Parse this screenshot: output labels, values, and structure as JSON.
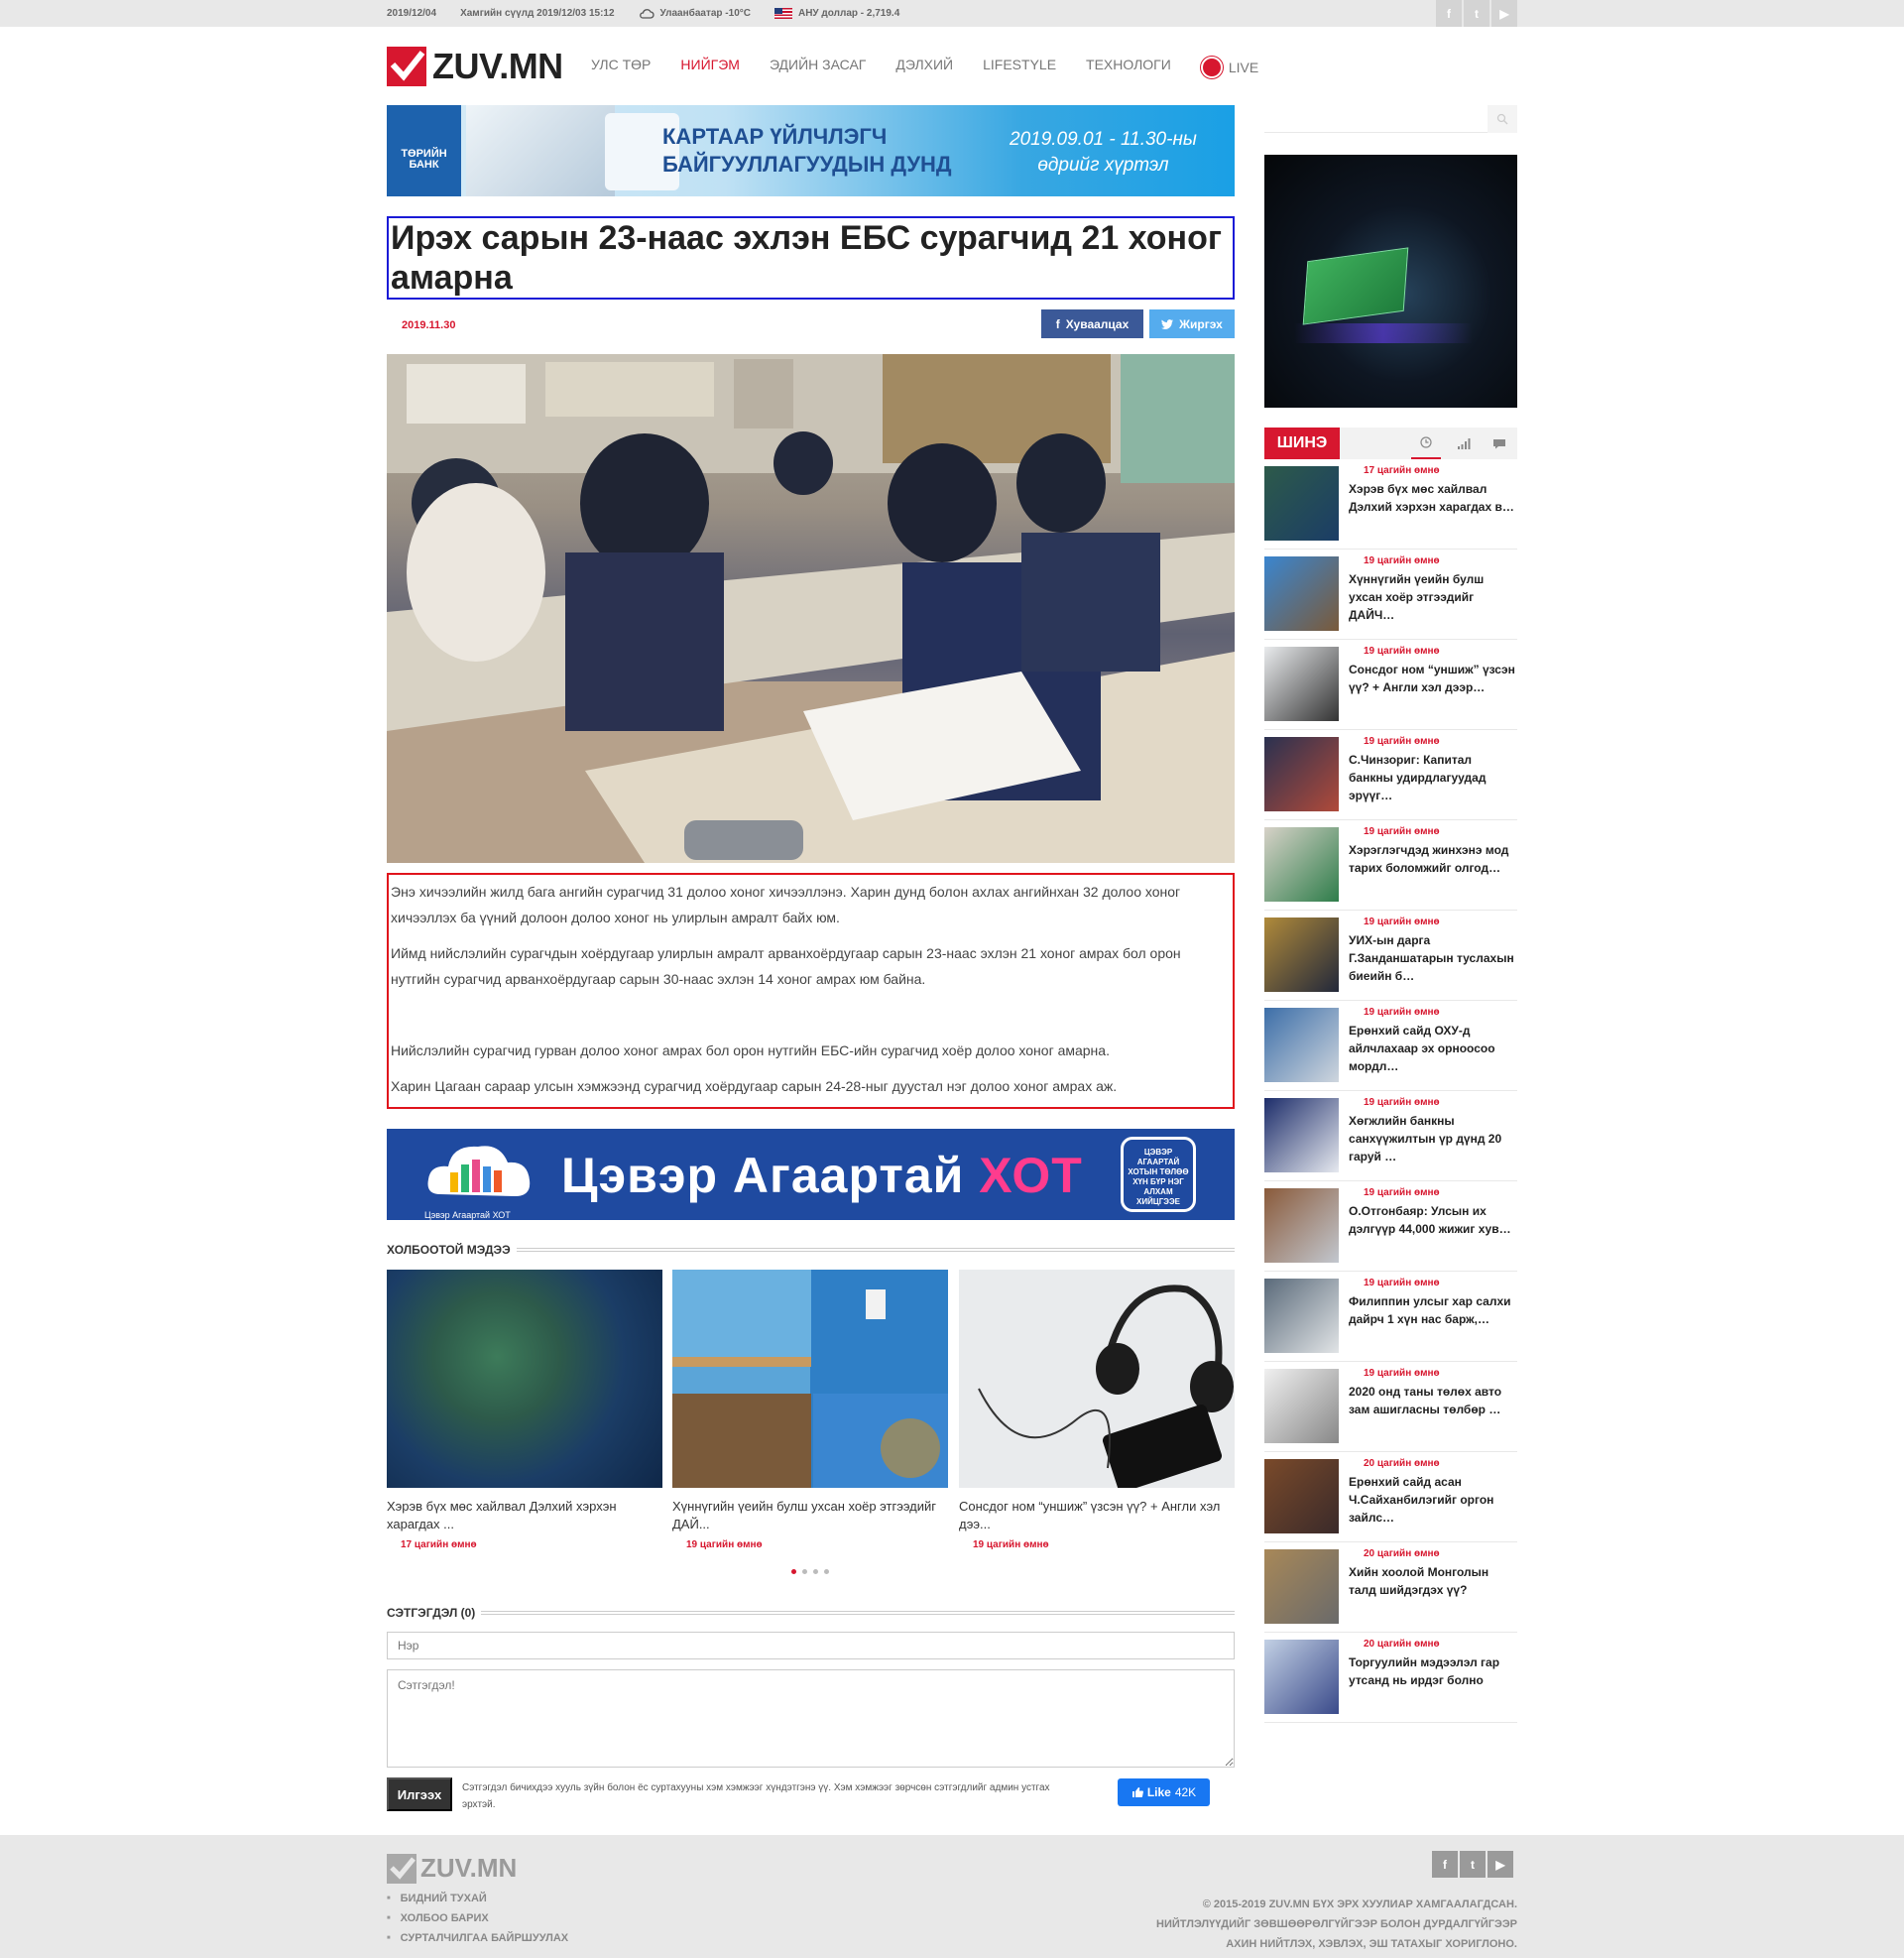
{
  "topbar": {
    "date": "2019/12/04",
    "last_updated": "Хамгийн сүүлд 2019/12/03 15:12",
    "weather": "Улаанбаатар -10°C",
    "currency": "АНУ доллар - 2,719.4",
    "socials": [
      "facebook-icon",
      "twitter-icon",
      "youtube-icon"
    ]
  },
  "header": {
    "logo_text": "ZUV.MN",
    "nav": [
      {
        "label": "УЛС ТӨР"
      },
      {
        "label": "НИЙГЭМ",
        "active": true
      },
      {
        "label": "ЭДИЙН ЗАСАГ"
      },
      {
        "label": "ДЭЛХИЙ"
      },
      {
        "label": "LIFESTYLE"
      },
      {
        "label": "ТЕХНОЛОГИ"
      },
      {
        "label": "LIVE"
      }
    ]
  },
  "banner": {
    "bank": "ТӨРИЙН БАНК",
    "title_line1": "КАРТААР ҮЙЛЧЛЭГЧ",
    "title_line2": "БАЙГУУЛЛАГУУДЫН ДУНД",
    "dates_line1": "2019.09.01 - 11.30-ны",
    "dates_line2": "өдрийг хүртэл"
  },
  "article": {
    "title": "Ирэх сарын 23-наас эхлэн ЕБС сурагчид 21 хоног амарна",
    "date": "2019.11.30",
    "share_fb": "Хуваалцах",
    "share_tw": "Жиргэх",
    "paragraphs": [
      "Энэ хичээлийн жилд бага ангийн сурагчид 31 долоо хоног хичээллэнэ. Харин дунд болон ахлах ангийнхан 32 долоо хоног хичээллэх ба үүний долоон долоо хоног нь улирлын амралт байх юм.",
      "Иймд нийслэлийн сурагчдын хоёрдугаар улирлын амралт арванхоёрдугаар сарын 23-наас эхлэн 21 хоног амрах бол орон нутгийн сурагчид арванхоёрдугаар сарын 30-наас эхлэн 14 хоног амрах юм байна.",
      "Нийслэлийн сурагчид гурван долоо хоног амрах бол орон нутгийн ЕБС-ийн сурагчид хоёр долоо хоног амарна.",
      "Харин Цагаан сараар улсын хэмжээнд сурагчид хоёрдугаар сарын 24-28-ныг дуустал нэг долоо хоног амрах аж."
    ]
  },
  "clean_banner": {
    "text_main": "Цэвэр Агаартай ",
    "text_accent": "ХОТ",
    "small": "Цэвэр Агаартай ХОТ",
    "box": "ЦЭВЭР АГААРТАЙ ХОТЫН ТӨЛӨӨ ХҮН БҮР НЭГ АЛХАМ ХИЙЦГЭЭЕ"
  },
  "related": {
    "heading": "ХОЛБООТОЙ МЭДЭЭ",
    "items": [
      {
        "caption": "Хэрэв бүх мөс хайлвал Дэлхий хэрхэн харагдах ...",
        "time": "17 цагийн өмнө"
      },
      {
        "caption": "Хүннүгийн үеийн булш ухсан хоёр этгээдийг ДАЙ...",
        "time": "19 цагийн өмнө"
      },
      {
        "caption": "Сонсдог ном “уншиж” үзсэн үү? + Англи хэл дээ...",
        "time": "19 цагийн өмнө"
      }
    ]
  },
  "comments": {
    "heading": "СЭТГЭГДЭЛ (0)",
    "name_placeholder": "Нэр",
    "comment_placeholder": "Сэтгэгдэл!",
    "send": "Илгээх",
    "notice": "Сэтгэгдэл бичихдээ хууль зүйн болон ёс суртахууны хэм хэмжээг хүндэтгэнэ үү. Хэм хэмжээг зөрчсөн сэтгэгдлийг админ устгах эрхтэй.",
    "like": "Like",
    "like_count": "42K"
  },
  "sidebar": {
    "tab_new": "ШИНЭ",
    "tab_icons": [
      "clock-icon",
      "signal-icon",
      "comment-icon"
    ],
    "news": [
      {
        "time": "17 цагийн өмнө",
        "title": "Хэрэв бүх мөс хайлвал Дэлхий хэрхэн харагдах в…"
      },
      {
        "time": "19 цагийн өмнө",
        "title": "Хүннүгийн үеийн булш ухсан хоёр этгээдийг ДАЙЧ…"
      },
      {
        "time": "19 цагийн өмнө",
        "title": "Сонсдог ном “уншиж” үзсэн үү? + Англи хэл дээр…"
      },
      {
        "time": "19 цагийн өмнө",
        "title": "С.Чинзориг: Капитал банкны удирдлагуудад эрүүг…"
      },
      {
        "time": "19 цагийн өмнө",
        "title": "Хэрэглэгчдэд жинхэнэ мод тарих боломжийг олгод…"
      },
      {
        "time": "19 цагийн өмнө",
        "title": "УИХ-ын дарга Г.Занданшатарын туслахын биеийн б…"
      },
      {
        "time": "19 цагийн өмнө",
        "title": "Ерөнхий сайд ОХУ-д айлчлахаар эх орноосоо мордл…"
      },
      {
        "time": "19 цагийн өмнө",
        "title": "Хөгжлийн банкны санхүүжилтын үр дүнд 20 гаруй …"
      },
      {
        "time": "19 цагийн өмнө",
        "title": "О.Отгонбаяр: Улсын их дэлгүүр 44,000 жижиг хув…"
      },
      {
        "time": "19 цагийн өмнө",
        "title": "Филиппин улсыг хар салхи дайрч 1 хүн нас барж,…"
      },
      {
        "time": "19 цагийн өмнө",
        "title": "2020 онд таны төлөх авто зам ашигласны төлбөр …"
      },
      {
        "time": "20 цагийн өмнө",
        "title": "Ерөнхий сайд асан Ч.Сайханбилэгийг оргон зайлс…"
      },
      {
        "time": "20 цагийн өмнө",
        "title": "Хийн хоолой Монголын талд шийдэгдэх үү?"
      },
      {
        "time": "20 цагийн өмнө",
        "title": "Торгуулийн мэдээлэл гар утсанд нь ирдэг болно"
      }
    ]
  },
  "footer": {
    "logo_text": "ZUV.MN",
    "links": [
      "БИДНИЙ ТУХАЙ",
      "ХОЛБОО БАРИХ",
      "СУРТАЛЧИЛГАА БАЙРШУУЛАХ"
    ],
    "copy_line1": "© 2015-2019 ZUV.MN БҮХ ЭРХ ХУУЛИАР ХАМГААЛАГДСАН.",
    "copy_line2": "НИЙТЛЭЛҮҮДИЙГ ЗӨВШӨӨРӨЛГҮЙГЭЭР БОЛОН ДУРДАЛГҮЙГЭЭР",
    "copy_line3": "АХИН НИЙТЛЭХ, ХЭВЛЭХ, ЭШ ТАТАХЫГ ХОРИГЛОНО."
  }
}
